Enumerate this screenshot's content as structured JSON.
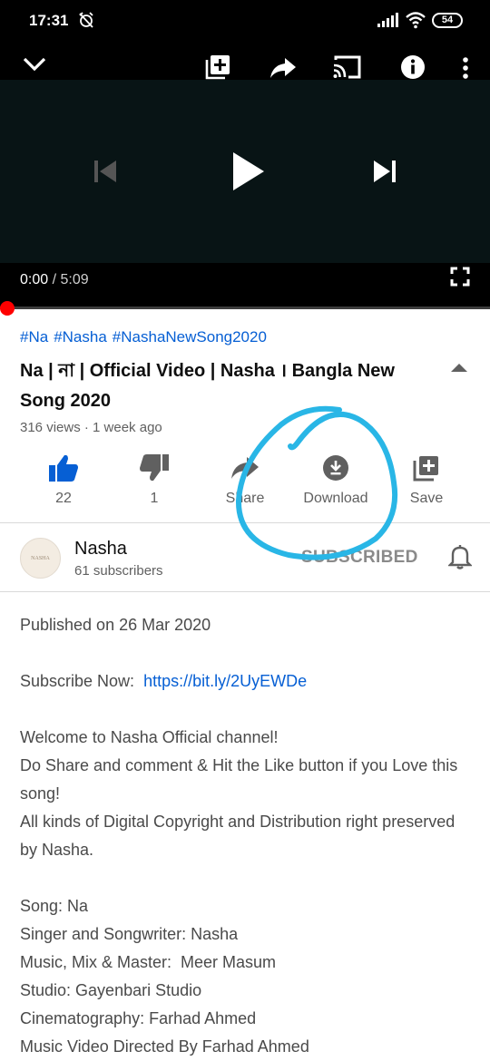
{
  "status_bar": {
    "time": "17:31",
    "battery": "54",
    "icons": [
      "alarm-off-icon",
      "signal-icon",
      "wifi-icon",
      "battery-icon"
    ]
  },
  "player": {
    "top_controls": [
      "minimize-chevron-icon",
      "add-to-queue-icon",
      "share-arrow-icon",
      "cast-icon",
      "info-icon",
      "more-vert-icon"
    ],
    "current_time": "0:00",
    "separator": " / ",
    "duration": "5:09",
    "progress_fraction": 0.0
  },
  "video": {
    "hashtags": [
      "#Na",
      "#Nasha",
      "#NashaNewSong2020"
    ],
    "title": "Na | না | Official Video | Nasha । Bangla New Song 2020",
    "meta": "316 views · 1 week ago"
  },
  "actions": {
    "like": {
      "label": "22",
      "icon": "thumbs-up-icon"
    },
    "dislike": {
      "label": "1",
      "icon": "thumbs-down-icon"
    },
    "share": {
      "label": "Share",
      "icon": "share-icon"
    },
    "download": {
      "label": "Download",
      "icon": "download-icon"
    },
    "save": {
      "label": "Save",
      "icon": "save-playlist-icon"
    }
  },
  "channel": {
    "avatar_text": "NASHA",
    "name": "Nasha",
    "subscribers": "61 subscribers",
    "subscribe_state": "SUBSCRIBED"
  },
  "description": {
    "published": "Published on 26 Mar 2020",
    "subscribe_prefix": "Subscribe Now:  ",
    "subscribe_link": "https://bit.ly/2UyEWDe",
    "welcome_lines": [
      "Welcome to Nasha Official channel!",
      "Do Share and comment & Hit the Like button if you Love this song!",
      "All kinds of Digital Copyright and Distribution right preserved by Nasha."
    ],
    "credits": [
      "Song: Na",
      "Singer and Songwriter: Nasha",
      "Music, Mix & Master:  Meer Masum",
      "Studio: Gayenbari Studio",
      "Cinematography: Farhad Ahmed",
      "Music Video Directed By Farhad Ahmed"
    ]
  },
  "colors": {
    "link": "#065fd4",
    "like_active": "#065fd4",
    "annotation": "#29b6e6",
    "progress": "#ff0000"
  }
}
